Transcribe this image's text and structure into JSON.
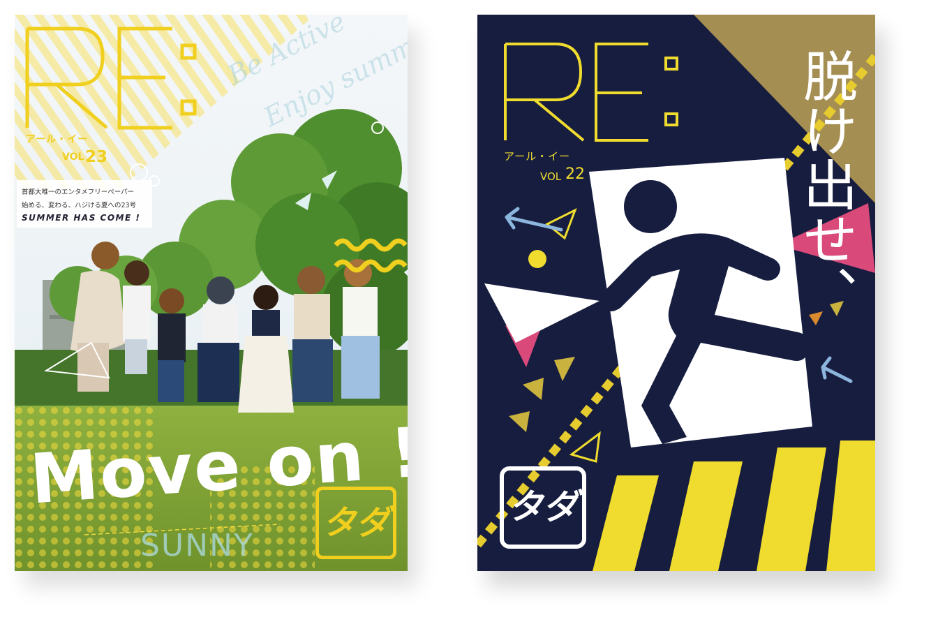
{
  "covers": [
    {
      "logo": "RE:",
      "kana": "アール・イー",
      "vol_label": "VOL",
      "vol_number": "23",
      "tagline_1": "首都大唯一のエンタメフリーペーパー",
      "tagline_2": "始める、変わる、ハジける夏への23号",
      "tagline_3": "SUMMER HAS COME !",
      "script_1": "Be Active",
      "script_2": "Enjoy summer",
      "main_title": "Move on !",
      "sub_title": "SUNNY",
      "badge": "タダ",
      "accent_color": "#f0cf1e"
    },
    {
      "logo": "RE:",
      "kana": "アール・イー",
      "vol_label": "VOL",
      "vol_number": "22",
      "title": "脱け出せ、",
      "badge": "タダ",
      "accent_color": "#f0dc2e",
      "background_color": "#171d3f",
      "icon": "running-man-exit-icon"
    }
  ]
}
